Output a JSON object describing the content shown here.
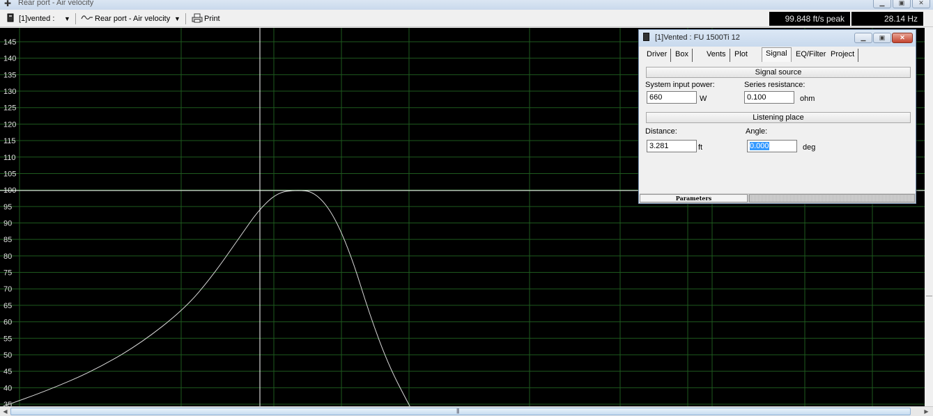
{
  "window": {
    "title": "Rear port - Air velocity",
    "icon": "pin-icon"
  },
  "toolbar": {
    "project_selector": "[1]vented :",
    "graph_selector": "Rear port - Air velocity",
    "print_label": "Print",
    "readout_peak": "99.848 ft/s peak",
    "readout_freq": "28.14 Hz"
  },
  "chart_data": {
    "type": "line",
    "title": "Rear port - Air velocity",
    "xlabel": "",
    "ylabel": "",
    "ylim": [
      35,
      148
    ],
    "y_ticks": [
      "145",
      "140",
      "135",
      "130",
      "125",
      "120",
      "115",
      "110",
      "105",
      "100",
      "95",
      "90",
      "85",
      "80",
      "75",
      "70",
      "65",
      "60",
      "55",
      "50",
      "45",
      "40",
      "35"
    ],
    "grid": true,
    "colors": {
      "background": "#000000",
      "grid": "#1e5a1e",
      "line": "#d8d8d8",
      "cursor": "#ffffff"
    },
    "cursor": {
      "x_hz": 28.14,
      "y": 99.848
    },
    "series": [
      {
        "values": [
          [
            0.0,
            34.0
          ],
          [
            0.05,
            39.0
          ],
          [
            0.1,
            45.0
          ],
          [
            0.15,
            53.0
          ],
          [
            0.2,
            64.0
          ],
          [
            0.23,
            74.0
          ],
          [
            0.26,
            86.0
          ],
          [
            0.28,
            94.0
          ],
          [
            0.3,
            99.2
          ],
          [
            0.32,
            100.0
          ],
          [
            0.34,
            99.5
          ],
          [
            0.36,
            93.0
          ],
          [
            0.38,
            80.0
          ],
          [
            0.4,
            62.0
          ],
          [
            0.42,
            47.0
          ],
          [
            0.44,
            36.0
          ],
          [
            0.45,
            31.0
          ]
        ]
      }
    ]
  },
  "dialog": {
    "title": "[1]Vented : FU 1500Ti 12",
    "tabs": [
      "Driver",
      "Box",
      "Vents",
      "Plot",
      "Signal",
      "EQ/Filter",
      "Project"
    ],
    "active_tab": "Signal",
    "signal_source": {
      "header": "Signal source",
      "power_label": "System input power:",
      "power_value": "660",
      "power_unit": "W",
      "resistance_label": "Series resistance:",
      "resistance_value": "0.100",
      "resistance_unit": "ohm"
    },
    "listening_place": {
      "header": "Listening place",
      "distance_label": "Distance:",
      "distance_value": "3.281",
      "distance_unit": "ft",
      "angle_label": "Angle:",
      "angle_value": "0.000",
      "angle_unit": "deg"
    },
    "status_label": "Parameters"
  }
}
